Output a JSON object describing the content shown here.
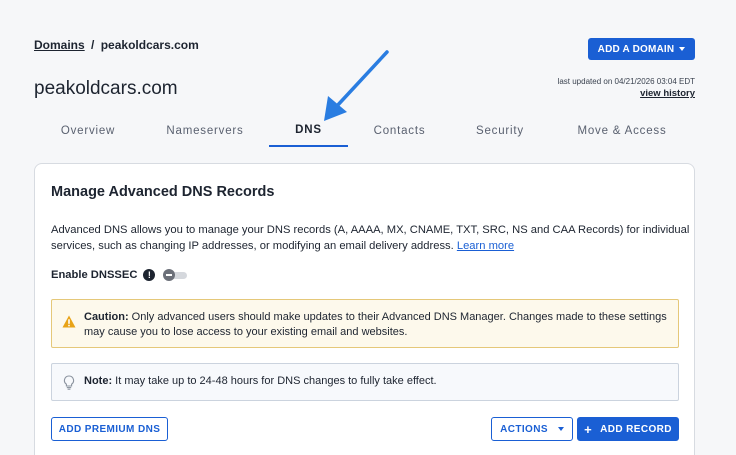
{
  "breadcrumb": {
    "root": "Domains",
    "separator": "/",
    "current": "peakoldcars.com"
  },
  "header": {
    "add_domain_label": "ADD A DOMAIN",
    "domain_title": "peakoldcars.com",
    "last_updated": "last updated on 04/21/2026 03:04 EDT",
    "view_history": "view history"
  },
  "tabs": [
    {
      "label": "Overview",
      "active": false
    },
    {
      "label": "Nameservers",
      "active": false
    },
    {
      "label": "DNS",
      "active": true
    },
    {
      "label": "Contacts",
      "active": false
    },
    {
      "label": "Security",
      "active": false
    },
    {
      "label": "Move & Access",
      "active": false
    }
  ],
  "card": {
    "title": "Manage Advanced DNS Records",
    "description": "Advanced DNS allows you to manage your DNS records (A, AAAA, MX, CNAME, TXT, SRC, NS and CAA Records) for individual services, such as changing IP addresses, or modifying an email delivery address.",
    "learn_more": "Learn more",
    "dnssec_label": "Enable DNSSEC",
    "dnssec_info_icon": "!",
    "dnssec_enabled": false,
    "caution_label": "Caution:",
    "caution_text": "Only advanced users should make updates to their Advanced DNS Manager. Changes made to these settings may cause you to lose access to your existing email and websites.",
    "note_label": "Note:",
    "note_text": "It may take up to 24-48 hours for DNS changes to fully take effect.",
    "add_premium_dns": "ADD PREMIUM DNS",
    "actions": "ACTIONS",
    "add_record": "ADD RECORD",
    "plus_glyph": "+"
  },
  "colors": {
    "accent": "#1a5fd4",
    "arrow": "#2a7de1",
    "caution_bg": "#fdf9ec",
    "caution_border": "#e5c879",
    "warning_icon": "#e8a317"
  },
  "icons": {
    "dropdown": "chevron-down-icon",
    "info": "info-icon",
    "warning": "warning-icon",
    "lightbulb": "lightbulb-icon",
    "plus": "plus-icon",
    "annotation": "arrow-annotation"
  }
}
